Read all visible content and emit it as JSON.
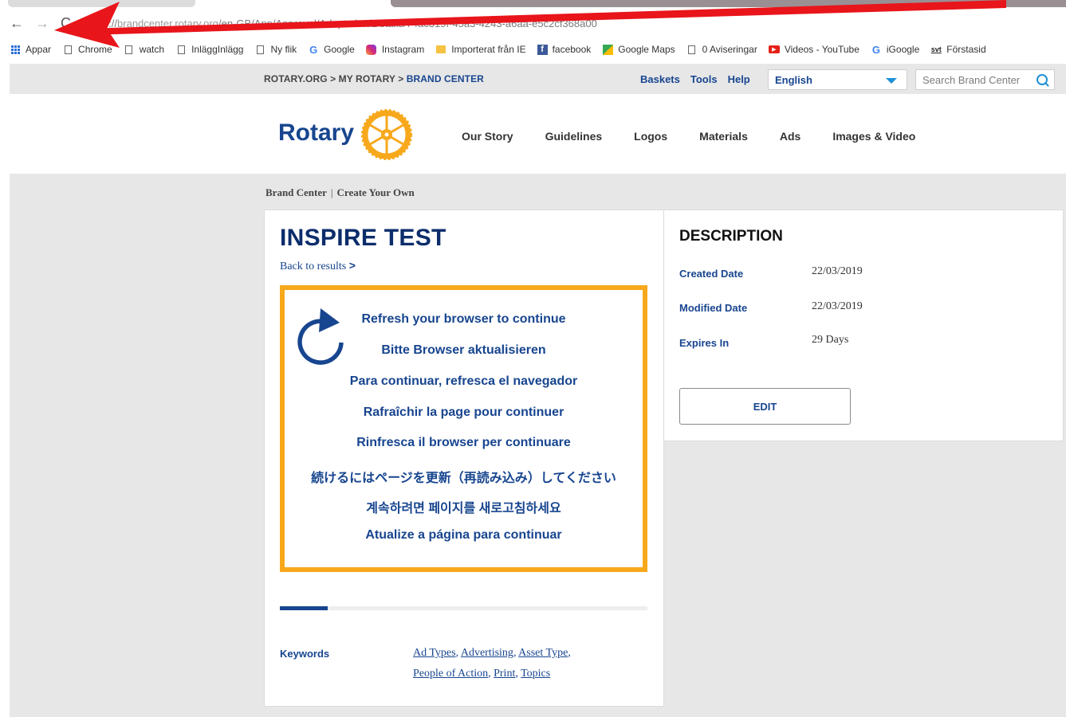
{
  "browser": {
    "url_scheme": "https://",
    "url_host": "brandcenter.rotary.org",
    "url_path": "/en-GB/App/Approval/Adaptation/Details/74ac319f-45a3-4243-a6aa-e5c2cf368a00",
    "bookmarks": [
      {
        "label": "Appar",
        "icon": "apps-grid-icon"
      },
      {
        "label": "Chrome",
        "icon": "page-icon"
      },
      {
        "label": "watch",
        "icon": "page-icon"
      },
      {
        "label": "InläggInlägg",
        "icon": "page-icon"
      },
      {
        "label": "Ny flik",
        "icon": "page-icon"
      },
      {
        "label": "Google",
        "icon": "google-icon"
      },
      {
        "label": "Instagram",
        "icon": "instagram-icon"
      },
      {
        "label": "Importerat från IE",
        "icon": "folder-icon"
      },
      {
        "label": "facebook",
        "icon": "facebook-icon"
      },
      {
        "label": "Google Maps",
        "icon": "maps-icon"
      },
      {
        "label": "0 Aviseringar",
        "icon": "page-icon"
      },
      {
        "label": "Videos - YouTube",
        "icon": "youtube-icon"
      },
      {
        "label": "iGoogle",
        "icon": "google-icon"
      },
      {
        "label": "Förstasid",
        "icon": "svt-icon"
      }
    ],
    "accent_annotation": "#e8151b"
  },
  "header": {
    "crumb_top": "ROTARY.ORG > MY ROTARY > ",
    "crumb_current": "BRAND CENTER",
    "util": {
      "baskets": "Baskets",
      "tools": "Tools",
      "help": "Help"
    },
    "language": "English",
    "search_placeholder": "Search Brand Center",
    "logo": "Rotary",
    "nav": [
      "Our Story",
      "Guidelines",
      "Logos",
      "Materials",
      "Ads",
      "Images & Video"
    ]
  },
  "breadcrumb": {
    "root": "Brand Center",
    "sep": "|",
    "current": "Create Your Own"
  },
  "asset": {
    "title": "INSPIRE TEST",
    "back_link": "Back to results",
    "back_arrow": ">",
    "messages": [
      "Refresh your browser to continue",
      "Bitte Browser aktualisieren",
      "Para continuar, refresca el navegador",
      "Rafraîchir la page pour continuer",
      "Rinfresca il browser per continuare",
      "続けるにはページを更新（再読み込み）してください",
      "계속하려면 페이지를 새로고침하세요",
      "Atualize a página para continuar"
    ],
    "progress": 0.13,
    "keywords_label": "Keywords",
    "keywords": [
      "Ad Types",
      "Advertising",
      "Asset Type",
      "People of Action",
      "Print",
      "Topics"
    ]
  },
  "description": {
    "title": "DESCRIPTION",
    "created_label": "Created Date",
    "created_value": "22/03/2019",
    "modified_label": "Modified Date",
    "modified_value": "22/03/2019",
    "expires_label": "Expires In",
    "expires_value": "29 Days",
    "edit_label": "EDIT"
  },
  "colors": {
    "rotary_blue": "#17458f",
    "rotary_gold": "#f7a81b"
  }
}
